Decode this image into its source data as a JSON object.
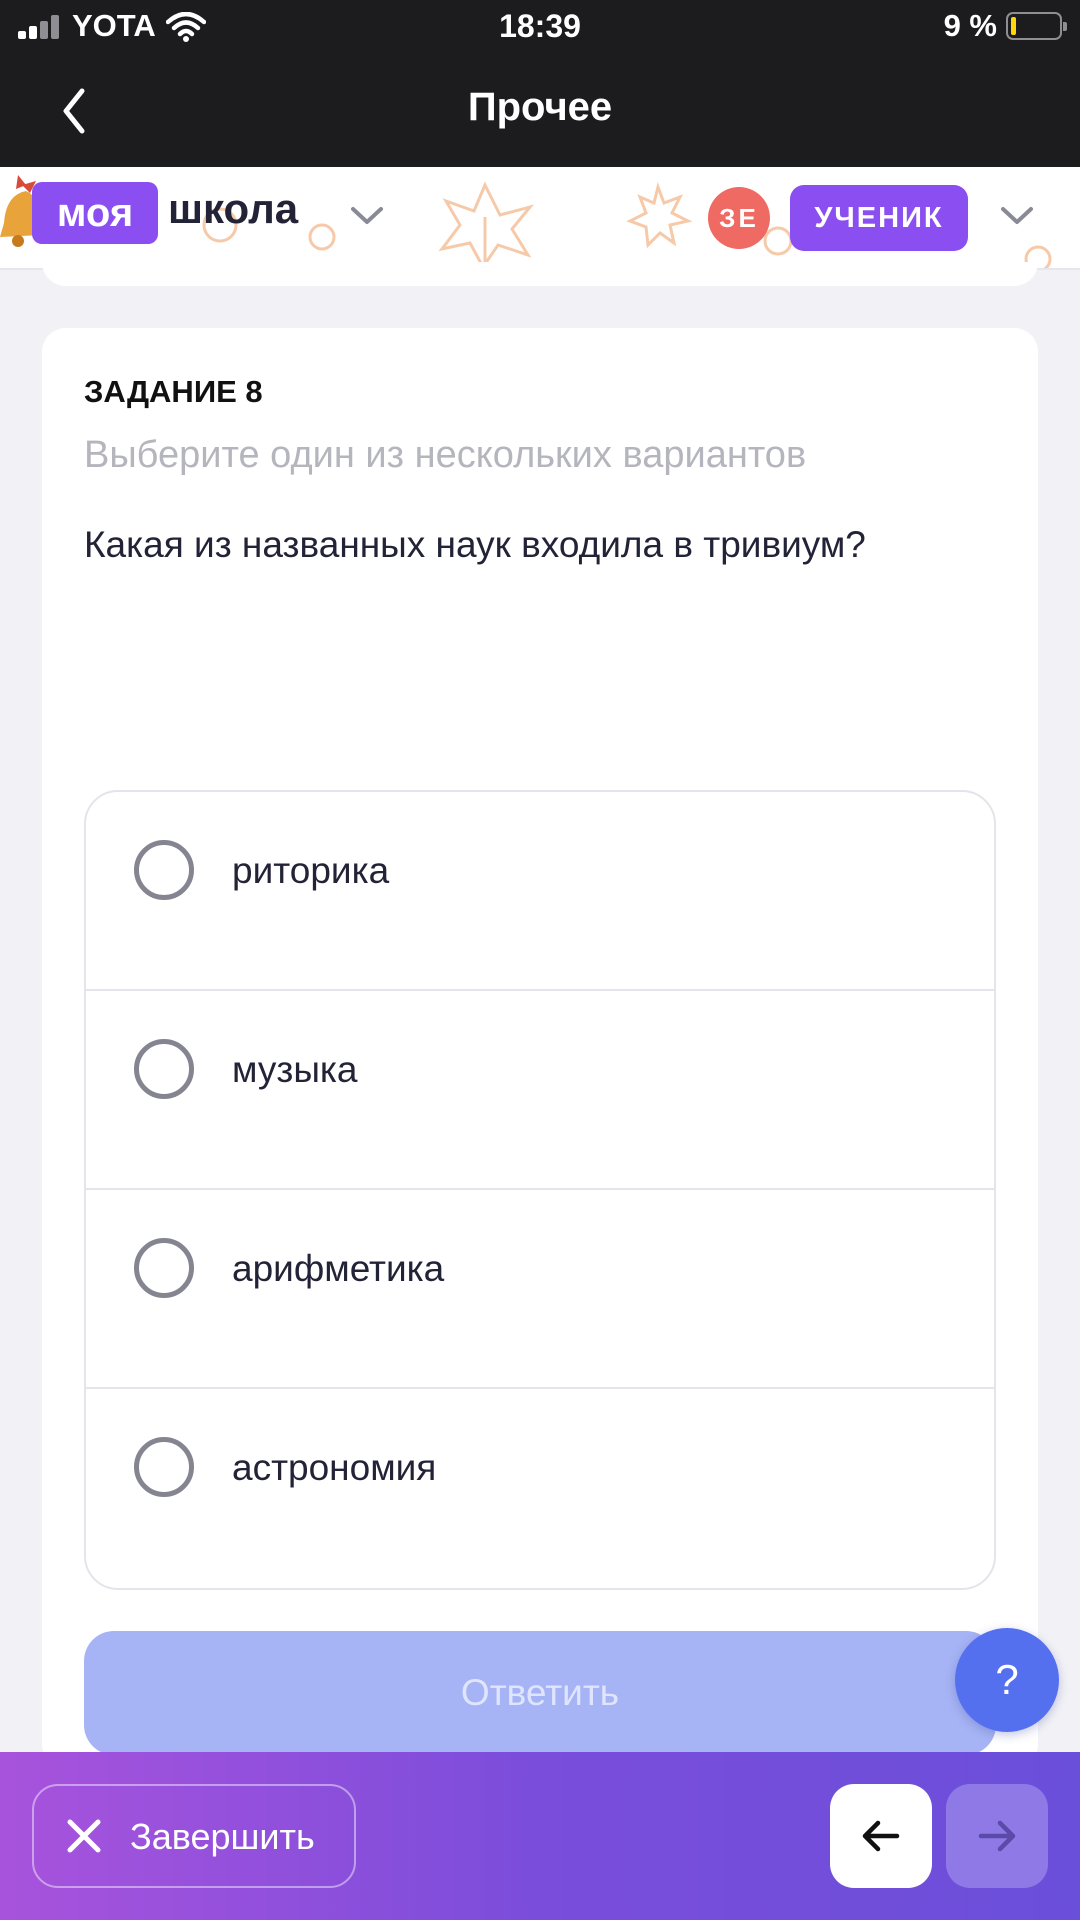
{
  "status_bar": {
    "carrier": "YOTA",
    "time": "18:39",
    "battery_percent": "9 %",
    "battery_level": 0.09
  },
  "nav": {
    "title": "Прочее",
    "back_icon": "chevron-left-icon"
  },
  "header": {
    "logo_box": "моя",
    "logo_word": "школа",
    "avatar_initials": "ЗЕ",
    "role": "УЧЕНИК",
    "colors": {
      "accent": "#8b4ef0",
      "avatar": "#ef6a63"
    }
  },
  "task": {
    "number_label": "ЗАДАНИЕ 8",
    "hint": "Выберите один из нескольких вариантов",
    "question": "Какая из названных наук входила в тривиум?",
    "options": [
      {
        "label": "риторика",
        "selected": false
      },
      {
        "label": "музыка",
        "selected": false
      },
      {
        "label": "арифметика",
        "selected": false
      },
      {
        "label": "астрономия",
        "selected": false
      }
    ],
    "answer_label": "Ответить"
  },
  "help": {
    "label": "?"
  },
  "footer": {
    "finish_label": "Завершить",
    "prev_icon": "arrow-left-icon",
    "next_icon": "arrow-right-icon",
    "colors": {
      "gradient_start": "#a853dc",
      "gradient_end": "#6a4fda"
    }
  }
}
